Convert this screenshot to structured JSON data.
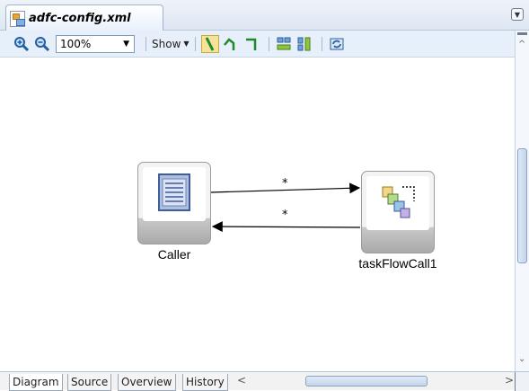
{
  "document_tab": {
    "title": "adfc-config.xml",
    "icon": "adfc-file-icon"
  },
  "toolbar": {
    "zoom_value": "100%",
    "show_label": "Show",
    "icons": [
      "zoom-in-icon",
      "zoom-out-icon",
      "straight-line-icon",
      "polyline-icon",
      "orthogonal-line-icon",
      "align-horizontal-icon",
      "align-vertical-icon",
      "refresh-layout-icon"
    ]
  },
  "diagram": {
    "nodes": [
      {
        "id": "caller",
        "label": "Caller",
        "icon": "view-activity-icon"
      },
      {
        "id": "taskFlowCall1",
        "label": "taskFlowCall1",
        "icon": "task-flow-call-icon"
      }
    ],
    "edges": [
      {
        "from": "caller",
        "to": "taskFlowCall1",
        "label": "*"
      },
      {
        "from": "taskFlowCall1",
        "to": "caller",
        "label": "*"
      }
    ]
  },
  "bottom_tabs": [
    {
      "label": "Diagram",
      "active": true
    },
    {
      "label": "Source",
      "active": false
    },
    {
      "label": "Overview",
      "active": false
    },
    {
      "label": "History",
      "active": false
    }
  ]
}
